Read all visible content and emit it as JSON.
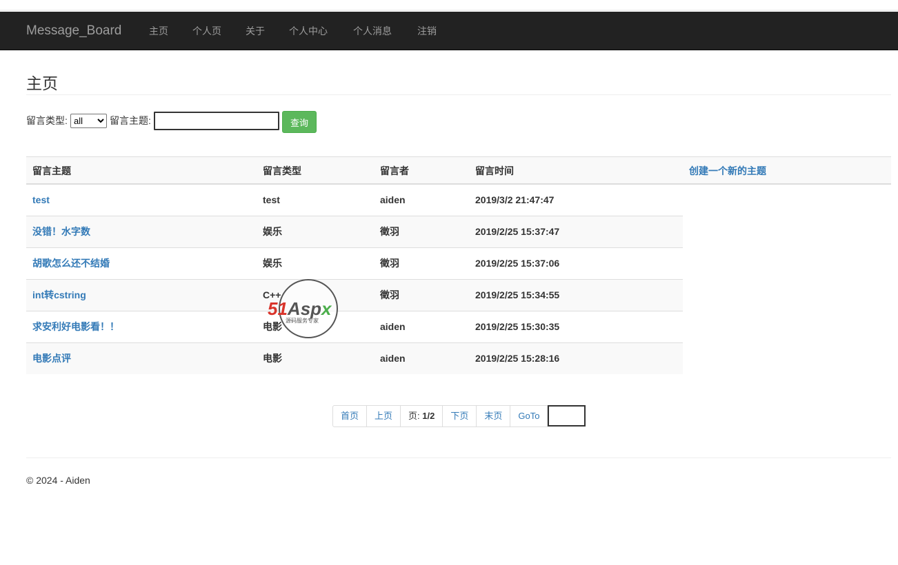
{
  "navbar": {
    "brand": "Message_Board",
    "links": [
      "主页",
      "个人页",
      "关于",
      "个人中心",
      "个人消息",
      "注销"
    ]
  },
  "page": {
    "title": "主页"
  },
  "search": {
    "type_label": "留言类型:",
    "type_selected": "all",
    "topic_label": "留言主题:",
    "topic_value": "",
    "query_button": "查询"
  },
  "table": {
    "headers": [
      "留言主题",
      "留言类型",
      "留言者",
      "留言时间"
    ],
    "create_link": "创建一个新的主题",
    "rows": [
      {
        "topic": "test",
        "type": "test",
        "author": "aiden",
        "time": "2019/3/2 21:47:47"
      },
      {
        "topic": "没错！水字数",
        "type": "娱乐",
        "author": "徵羽",
        "time": "2019/2/25 15:37:47"
      },
      {
        "topic": "胡歌怎么还不结婚",
        "type": "娱乐",
        "author": "徵羽",
        "time": "2019/2/25 15:37:06"
      },
      {
        "topic": "int转cstring",
        "type": "C++",
        "author": "徵羽",
        "time": "2019/2/25 15:34:55"
      },
      {
        "topic": "求安利好电影看！！",
        "type": "电影",
        "author": "aiden",
        "time": "2019/2/25 15:30:35"
      },
      {
        "topic": "电影点评",
        "type": "电影",
        "author": "aiden",
        "time": "2019/2/25 15:28:16"
      }
    ]
  },
  "pager": {
    "first": "首页",
    "prev": "上页",
    "page_label": "页: ",
    "page_value": "1/2",
    "next": "下页",
    "last": "末页",
    "goto": "GoTo",
    "goto_value": ""
  },
  "watermark": {
    "text": "51Aspx",
    "subtext": "源码服务专家"
  },
  "footer": {
    "text": "© 2024 - Aiden"
  },
  "colors": {
    "navbar_bg": "#222222",
    "link": "#337ab7",
    "btn_success": "#5cb85c"
  }
}
